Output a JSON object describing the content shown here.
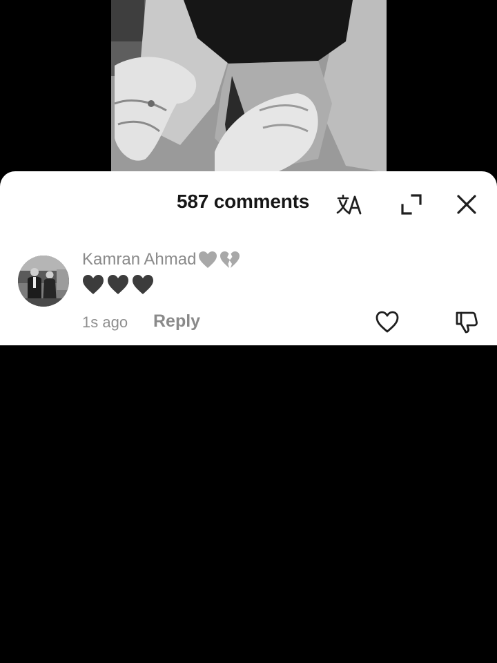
{
  "comments_panel": {
    "count_label": "587 comments",
    "translate_icon": "translate-icon",
    "expand_icon": "expand-icon",
    "close_icon": "close-icon"
  },
  "comments": [
    {
      "username": "Kamran Ahmad",
      "username_emojis": [
        "grey-heart-icon",
        "broken-heart-icon"
      ],
      "text_emojis": [
        "black-heart-icon",
        "black-heart-icon",
        "black-heart-icon"
      ],
      "timestamp": "1s ago",
      "reply_label": "Reply",
      "like_icon": "heart-outline-icon",
      "dislike_icon": "thumbs-down-icon"
    }
  ],
  "colors": {
    "background": "#000000",
    "sheet": "#ffffff",
    "title_text": "#161616",
    "secondary_text": "#8a8a8a",
    "icon_stroke": "#1f1f1f"
  }
}
